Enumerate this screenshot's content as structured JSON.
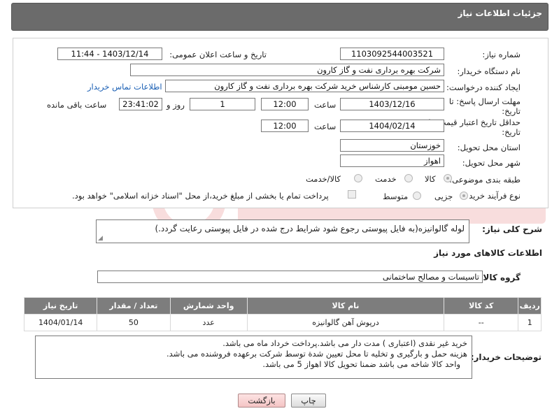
{
  "header": {
    "title": "جزئیات اطلاعات نیاز"
  },
  "form": {
    "need_number": {
      "label": "شماره نیاز:",
      "value": "1103092544003521"
    },
    "announce_datetime": {
      "label": "تاریخ و ساعت اعلان عمومی:",
      "value": "1403/12/14 - 11:44"
    },
    "buyer_org": {
      "label": "نام دستگاه خریدار:",
      "value": "شرکت بهره برداری نفت و گاز کارون"
    },
    "requester": {
      "label": "ایجاد کننده درخواست:",
      "value": "حسین مومبنی کارشناس خرید شرکت بهره برداری نفت و گاز کارون",
      "contact_link": "اطلاعات تماس خریدار"
    },
    "reply_deadline": {
      "label_line1": "مهلت ارسال پاسخ: تا",
      "label_line2": "تاریخ:",
      "date": "1403/12/16",
      "time_label": "ساعت",
      "time": "12:00",
      "days": "1",
      "days_label": "روز و",
      "remaining": "23:41:02",
      "remaining_label": "ساعت باقی مانده"
    },
    "price_validity": {
      "label_line1": "حداقل تاریخ اعتبار قیمت: تا",
      "label_line2": "تاریخ:",
      "date": "1404/02/14",
      "time_label": "ساعت",
      "time": "12:00"
    },
    "province": {
      "label": "استان محل تحویل:",
      "value": "خوزستان"
    },
    "city": {
      "label": "شهر محل تحویل:",
      "value": "اهواز"
    },
    "category": {
      "label": "طبقه بندی موضوعی:",
      "options": [
        "کالا",
        "خدمت",
        "کالا/خدمت"
      ],
      "selected": "کالا"
    },
    "purchase_process": {
      "label": "نوع فرآیند خرید :",
      "options": [
        "جزیی",
        "متوسط"
      ],
      "selected": "جزیی",
      "treasury_note": "پرداخت تمام یا بخشی از مبلغ خرید،از محل \"اسناد خزانه اسلامی\" خواهد بود."
    }
  },
  "description": {
    "label": "شرح کلی نیاز:",
    "value": "لوله گالوانیزه(به فایل پیوستی رجوع شود شرایط درج شده در فایل پیوستی رعایت گردد.)"
  },
  "goods_section": {
    "title": "اطلاعات کالاهای مورد نیاز",
    "group_label": "گروه کالا:",
    "group_value": "تاسیسات و مصالح ساختمانی",
    "columns": [
      "ردیف",
      "کد کالا",
      "نام کالا",
      "واحد شمارش",
      "تعداد / مقدار",
      "تاریخ نیاز"
    ],
    "rows": [
      [
        "1",
        "--",
        "درپوش آهن گالوانیزه",
        "عدد",
        "50",
        "1404/01/14"
      ]
    ]
  },
  "buyer_notes": {
    "label": "توضیحات خریدار:",
    "lines": [
      "خرید غیر نقدی (اعتباری ) مدت دار می باشد.پرداخت خرداد ماه می باشد.",
      "هزینه حمل و بارگیری و تخلیه تا محل تعیین شدة توسط شرکت برعهده فروشنده می باشد.",
      "واحد کالا شاخه می باشد ضمنا تحویل کالا اهواز 5 می باشد."
    ]
  },
  "buttons": {
    "print": "چاپ",
    "back": "بازگشت"
  },
  "colors": {
    "header_bg": "#6b6b6b",
    "table_header_bg": "#7d7d7d",
    "link": "#1a5fb4",
    "back_button": "#f4c4c4"
  }
}
